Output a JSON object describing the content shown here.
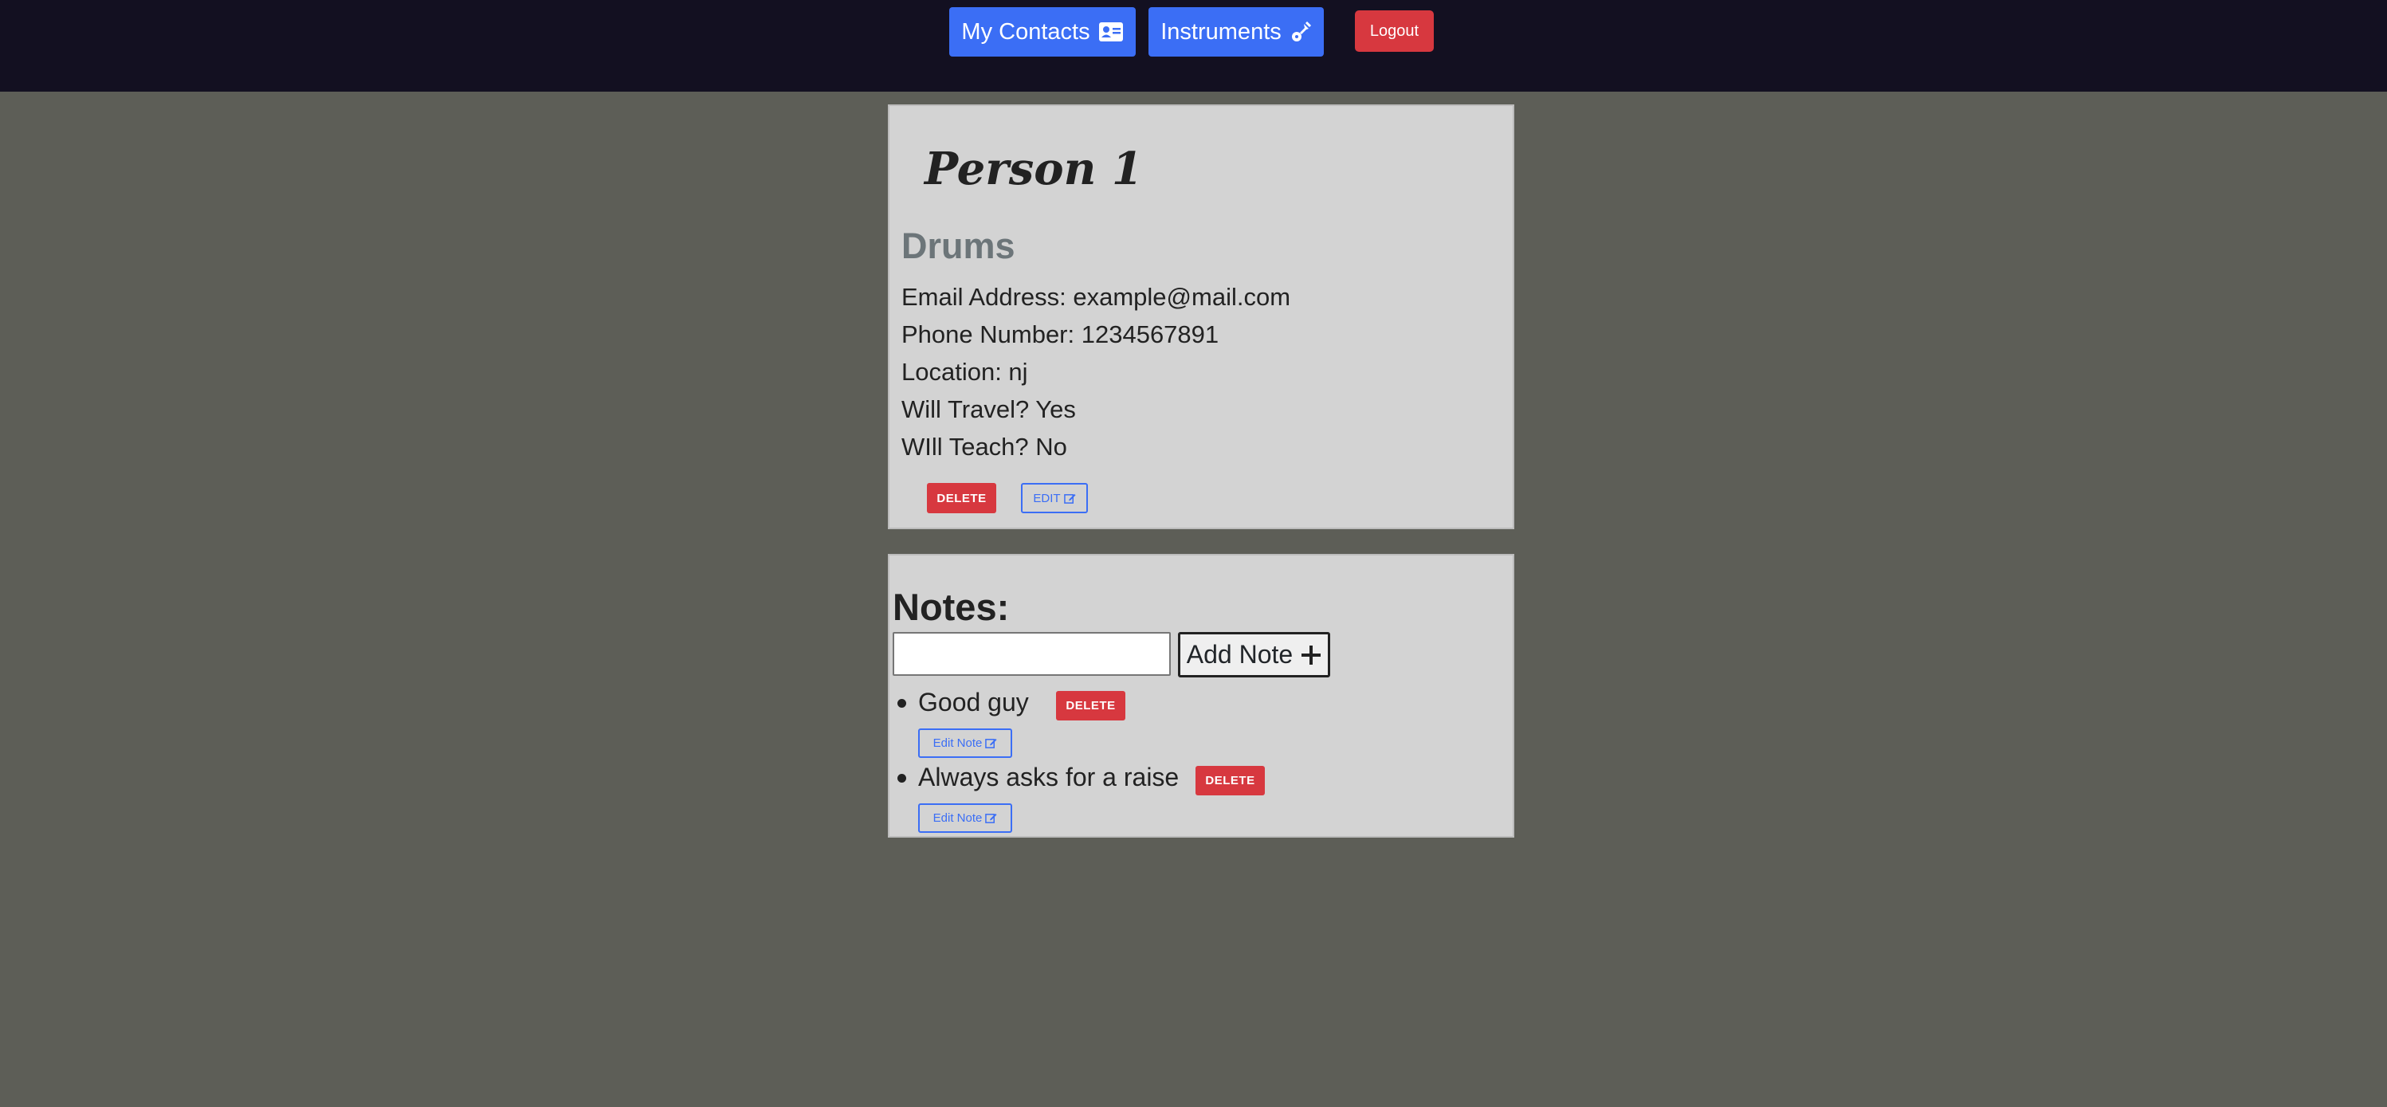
{
  "nav": {
    "contacts_label": "My Contacts",
    "instruments_label": "Instruments",
    "logout_label": "Logout"
  },
  "contact": {
    "name": "Person 1",
    "instrument": "Drums",
    "email": "Email Address: example@mail.com",
    "phone": "Phone Number: 1234567891",
    "location": "Location: nj",
    "travel": "Will Travel? Yes",
    "teach": "WIll Teach? No",
    "delete_label": "DELETE",
    "edit_label": "EDIT"
  },
  "notes": {
    "title": "Notes:",
    "input_value": "",
    "add_label": "Add Note",
    "items": [
      {
        "text": "Good guy",
        "delete_label": "DELETE",
        "edit_label": "Edit Note"
      },
      {
        "text": "Always asks for a raise",
        "delete_label": "DELETE",
        "edit_label": "Edit Note"
      }
    ]
  },
  "colors": {
    "page_bg": "#5d5e57",
    "topbar_bg": "#131021",
    "primary": "#3b6ef5",
    "danger": "#d7383f",
    "card_bg": "#d3d3d3"
  },
  "icons": {
    "contacts": "contact-card-icon",
    "instruments": "guitar-icon",
    "edit": "edit-icon",
    "add": "plus-icon"
  }
}
